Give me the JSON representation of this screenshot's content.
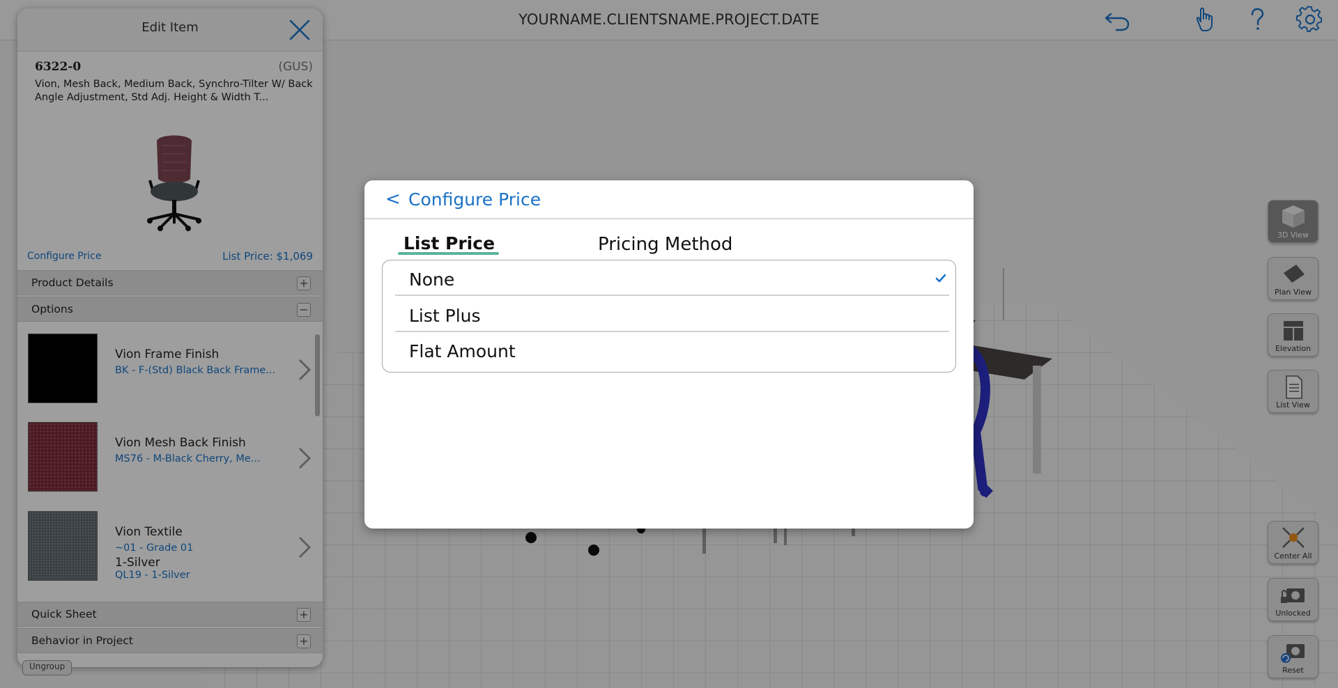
{
  "topbar": {
    "project_title": "YOURNAME.CLIENTSNAME.PROJECT.DATE",
    "icons": [
      "undo-icon",
      "hand-gesture-icon",
      "help-icon",
      "settings-gear-icon"
    ]
  },
  "view_buttons": [
    {
      "label": "3D View",
      "icon": "cube-icon",
      "active": true
    },
    {
      "label": "Plan View",
      "icon": "plan-view-icon",
      "active": false
    },
    {
      "label": "Elevation",
      "icon": "elevation-icon",
      "active": false
    },
    {
      "label": "List View",
      "icon": "list-view-icon",
      "active": false
    }
  ],
  "camera_buttons": [
    {
      "label": "Center All",
      "icon": "center-all-icon"
    },
    {
      "label": "Unlocked",
      "icon": "camera-unlocked-icon"
    },
    {
      "label": "Reset",
      "icon": "camera-reset-icon"
    }
  ],
  "edit_item": {
    "title": "Edit Item",
    "code": "6322-0",
    "vendor": "(GUS)",
    "description": "Vion, Mesh Back, Medium Back, Synchro-Tilter W/ Back Angle Adjustment, Std Adj. Height & Width T...",
    "configure_price_link": "Configure Price",
    "list_price": "List Price: $1,069",
    "sections": {
      "product_details": "Product Details",
      "options": "Options",
      "quick_sheet": "Quick Sheet",
      "behavior": "Behavior in Project"
    },
    "options": [
      {
        "name": "Vion Frame Finish",
        "value": "BK - F-(Std) Black Back Frame...",
        "swatch_color": "#000000"
      },
      {
        "name": "Vion Mesh Back Finish",
        "value": "MS76 - M-Black Cherry, Me...",
        "swatch_color": "#7a2c38"
      },
      {
        "name": "Vion Textile",
        "value": "~01 - Grade 01",
        "value2": "1-Silver",
        "value3": "QL19 - 1-Silver",
        "swatch_color": "#5c666c"
      }
    ],
    "ungroup": "Ungroup"
  },
  "modal": {
    "back": "<",
    "title": "Configure Price",
    "tab_list_price": "List Price",
    "tab_pricing_method": "Pricing Method",
    "methods": [
      {
        "label": "None",
        "selected": true
      },
      {
        "label": "List Plus",
        "selected": false
      },
      {
        "label": "Flat Amount",
        "selected": false
      }
    ]
  },
  "colors": {
    "accent": "#1a72c7",
    "tab_underline": "#5ab3a0"
  }
}
